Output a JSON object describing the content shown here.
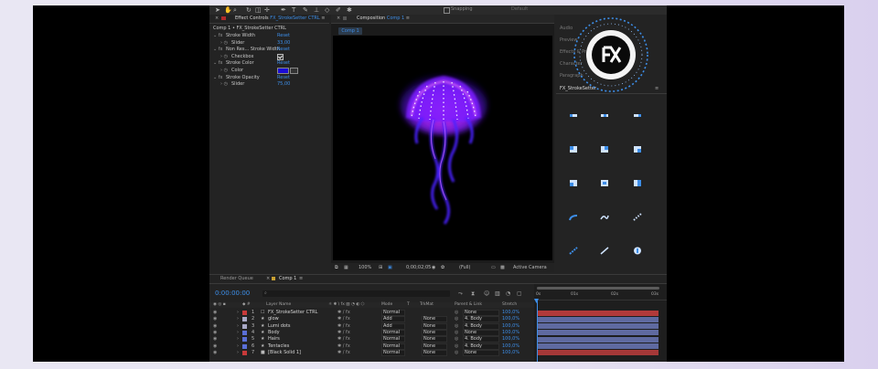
{
  "toolbar": {
    "snapping": "Snapping",
    "default": "Default"
  },
  "effect_controls": {
    "tab_prefix": "Effect Controls",
    "tab_layer": "FX_StrokeSetter CTRL",
    "tab_suffix": "≡",
    "subtitle": "Comp 1 • FX_StrokeSetter CTRL",
    "rows": [
      {
        "label": "Stroke Width",
        "value": "Reset",
        "indent": 0,
        "kind": "fx"
      },
      {
        "label": "Slider",
        "value": "33,00",
        "indent": 1,
        "kind": "param"
      },
      {
        "label": "Non Res... Stroke Width",
        "value": "Reset",
        "indent": 0,
        "kind": "fx"
      },
      {
        "label": "Checkbox",
        "value": "",
        "indent": 1,
        "kind": "checkbox"
      },
      {
        "label": "Stroke Color",
        "value": "Reset",
        "indent": 0,
        "kind": "fx"
      },
      {
        "label": "Color",
        "value": "",
        "indent": 1,
        "kind": "color"
      },
      {
        "label": "Stroke Opacity",
        "value": "Reset",
        "indent": 0,
        "kind": "fx"
      },
      {
        "label": "Slider",
        "value": "75,00",
        "indent": 1,
        "kind": "param"
      }
    ],
    "stroke_color": "#1a0bd6"
  },
  "composition": {
    "tab_prefix": "Composition",
    "tab_name": "Comp 1",
    "tab_suffix": "≡",
    "subtab": "Comp 1",
    "zoom": "100%",
    "timecode": "0;00;02;05",
    "resolution": "(Full)",
    "camera": "Active Camera"
  },
  "right_panel": {
    "items": [
      "Audio",
      "Preview",
      "Effects & Presets",
      "Character",
      "Paragraph"
    ],
    "fx_title": "FX_StrokeSetter",
    "fx_menu": "≡",
    "icon_names": [
      "align-left-icon",
      "align-center-icon",
      "align-right-icon",
      "corner-tl-icon",
      "corner-tr-icon",
      "corner-br-icon",
      "corner-bl-icon",
      "square-join-icon",
      "square-cap-icon",
      "round-curve-icon",
      "wave-curve-icon",
      "dotted-line-icon",
      "dashed-diag-icon",
      "line-diag-icon",
      "color-drop-icon"
    ]
  },
  "badge": {
    "text": "FX"
  },
  "timeline": {
    "tabs": [
      "Render Queue",
      "Comp 1"
    ],
    "tab_suffix": "≡",
    "timecode": "0:00:00:00",
    "search_icon": "search-icon",
    "headers": {
      "layer_name": "Layer Name",
      "mode": "Mode",
      "t": "T",
      "trkmat": "TrkMat",
      "parent": "Parent & Link",
      "stretch": "Stretch"
    },
    "ruler": [
      "0s",
      "01s",
      "02s",
      "03s"
    ],
    "layers": [
      {
        "num": "1",
        "name": "FX_StrokeSetter CTRL",
        "color": "#c83a3a",
        "mode": "Normal",
        "trkmat": "",
        "parent": "None",
        "stretch": "100,0%",
        "bar": "#b23a3a"
      },
      {
        "num": "2",
        "name": "glow",
        "color": "#a9a9c6",
        "mode": "Add",
        "trkmat": "None",
        "parent": "4. Body",
        "stretch": "100,0%",
        "bar": "#5f6aa0"
      },
      {
        "num": "3",
        "name": "Lumi dots",
        "color": "#a9a9c6",
        "mode": "Add",
        "trkmat": "None",
        "parent": "4. Body",
        "stretch": "100,0%",
        "bar": "#5f6aa0"
      },
      {
        "num": "4",
        "name": "Body",
        "color": "#5a6fd6",
        "mode": "Normal",
        "trkmat": "None",
        "parent": "None",
        "stretch": "100,0%",
        "bar": "#5f6aa0"
      },
      {
        "num": "5",
        "name": "Hairs",
        "color": "#5a6fd6",
        "mode": "Normal",
        "trkmat": "None",
        "parent": "4. Body",
        "stretch": "100,0%",
        "bar": "#5f6aa0"
      },
      {
        "num": "6",
        "name": "Tentacles",
        "color": "#5a6fd6",
        "mode": "Normal",
        "trkmat": "None",
        "parent": "4. Body",
        "stretch": "100,0%",
        "bar": "#5f6aa0"
      },
      {
        "num": "7",
        "name": "[Black Solid 1]",
        "color": "#c83a3a",
        "mode": "Normal",
        "trkmat": "None",
        "parent": "None",
        "stretch": "100,0%",
        "bar": "#a53838"
      }
    ]
  }
}
